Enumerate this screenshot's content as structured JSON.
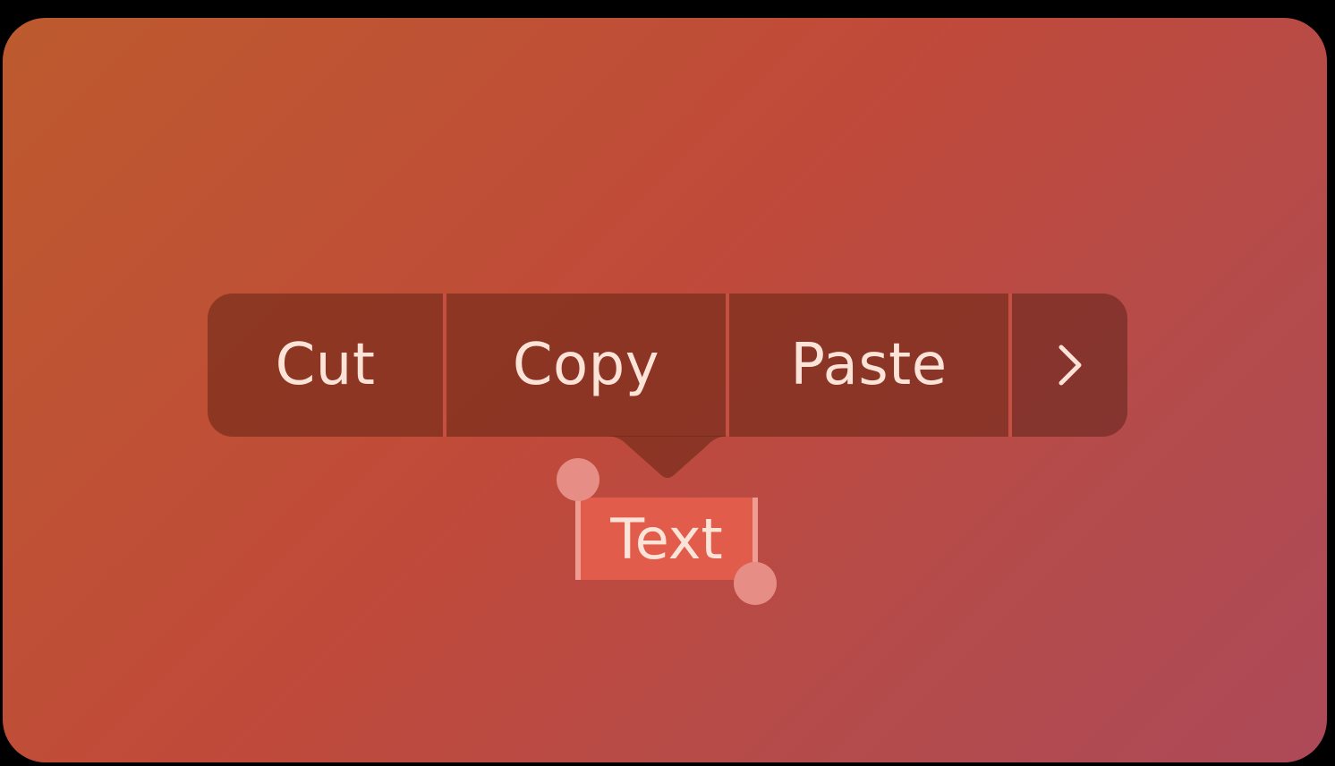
{
  "menu": {
    "cut_label": "Cut",
    "copy_label": "Copy",
    "paste_label": "Paste",
    "more_icon": "chevron-right-icon"
  },
  "selection": {
    "text": "Text"
  },
  "colors": {
    "background_start": "#bd5a2e",
    "background_end": "#ad4a58",
    "menu_fill": "#6e2816",
    "text": "#fbe3d8",
    "selection_highlight": "#e25c4c",
    "handle": "#e68d86"
  }
}
